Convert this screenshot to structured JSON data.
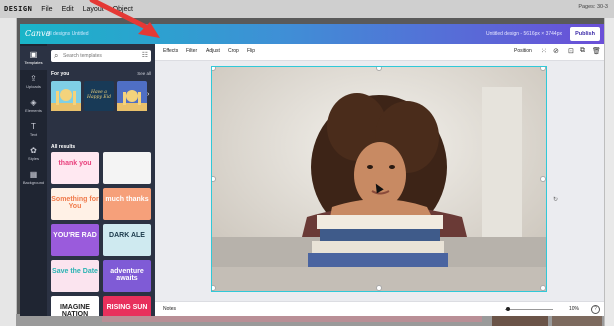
{
  "host": {
    "brand": "DESIGN",
    "menu": [
      "File",
      "Edit",
      "Layout",
      "Object"
    ],
    "pages_text": "Pages: 30-3"
  },
  "canva": {
    "logo": "Canva",
    "breadcrumb": "All designs  Untitled",
    "doc_title": "Untitled design - 5616px × 3744px",
    "publish_label": "Publish"
  },
  "rail": [
    {
      "label": "Templates",
      "icon": "templates-icon",
      "glyph": "▣"
    },
    {
      "label": "Uploads",
      "icon": "upload-icon",
      "glyph": "⇪"
    },
    {
      "label": "Elements",
      "icon": "elements-icon",
      "glyph": "◈"
    },
    {
      "label": "Text",
      "icon": "text-icon",
      "glyph": "T"
    },
    {
      "label": "Styles",
      "icon": "styles-icon",
      "glyph": "✿"
    },
    {
      "label": "Background",
      "icon": "background-icon",
      "glyph": "▦"
    }
  ],
  "panel": {
    "search_placeholder": "Search templates",
    "for_you": "For you",
    "see_all": "See all",
    "all_results": "All results"
  },
  "tiles": [
    {
      "text": "thank you",
      "bg": "#ffe8f1",
      "fg": "#e8417d"
    },
    {
      "text": "",
      "bg": "#f4f4f4",
      "fg": "#333"
    },
    {
      "text": "Something for You",
      "bg": "#fff1e6",
      "fg": "#f07a4a"
    },
    {
      "text": "much thanks",
      "bg": "#f6a07a",
      "fg": "#fff"
    },
    {
      "text": "YOU'RE RAD",
      "bg": "#9a5bdc",
      "fg": "#fff"
    },
    {
      "text": "DARK ALE",
      "bg": "#cfeaf0",
      "fg": "#1b3a4b"
    },
    {
      "text": "Save the Date",
      "bg": "#fbe4ef",
      "fg": "#2ab3b3"
    },
    {
      "text": "adventure awaits",
      "bg": "#7f5bd6",
      "fg": "#fff"
    },
    {
      "text": "IMAGINE NATION",
      "bg": "#ffffff",
      "fg": "#222"
    },
    {
      "text": "RISING SUN",
      "bg": "#e8305c",
      "fg": "#fff"
    }
  ],
  "toolbar": {
    "effects": "Effects",
    "filter": "Filter",
    "adjust": "Adjust",
    "crop": "Crop",
    "flip": "Flip",
    "position": "Position"
  },
  "footer": {
    "notes": "Notes",
    "zoom": "10%",
    "help": "?"
  }
}
